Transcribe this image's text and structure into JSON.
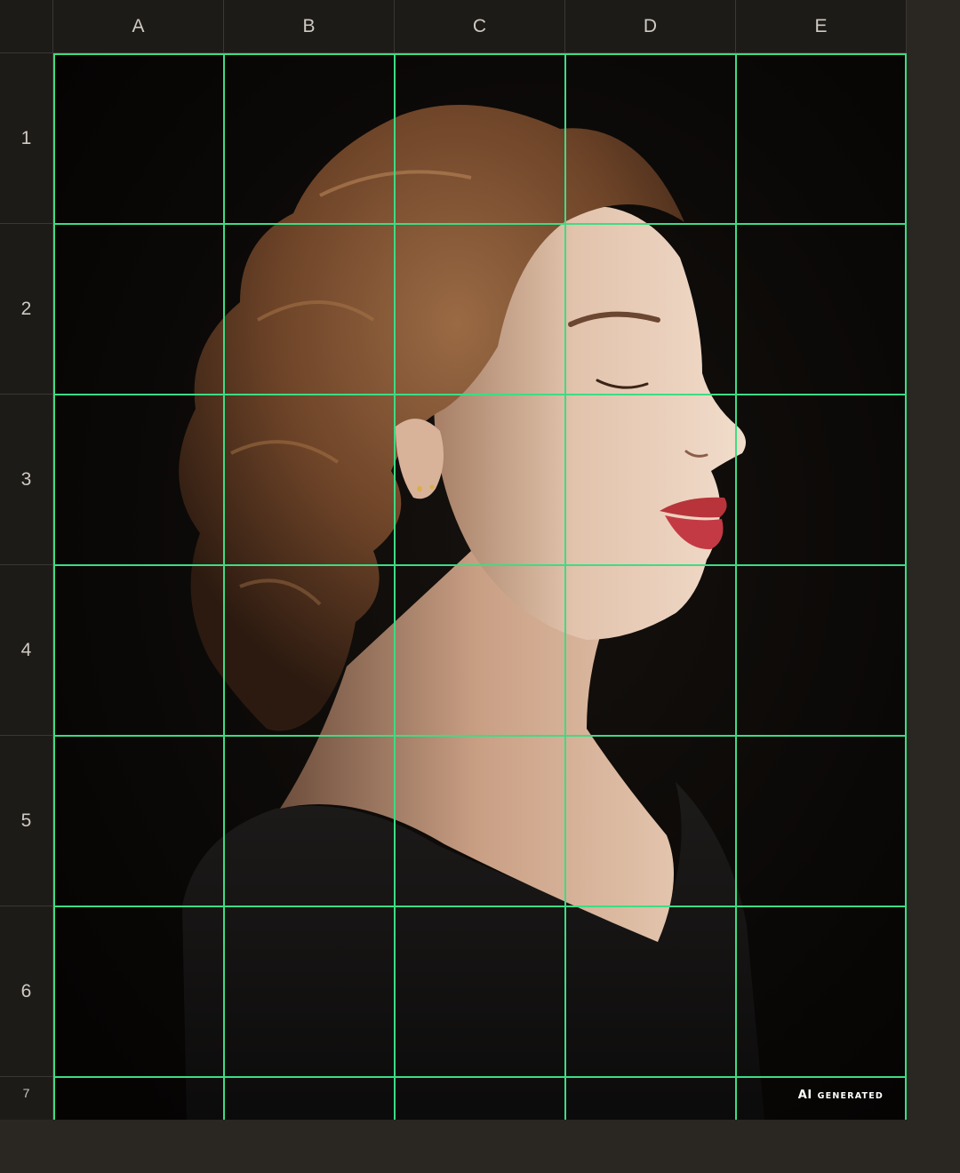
{
  "columns": [
    "A",
    "B",
    "C",
    "D",
    "E"
  ],
  "rows": [
    "1",
    "2",
    "3",
    "4",
    "5",
    "6",
    "7"
  ],
  "grid_color": "#3ddc84",
  "badge": {
    "ai": "AI",
    "generated": "GENERATED"
  }
}
